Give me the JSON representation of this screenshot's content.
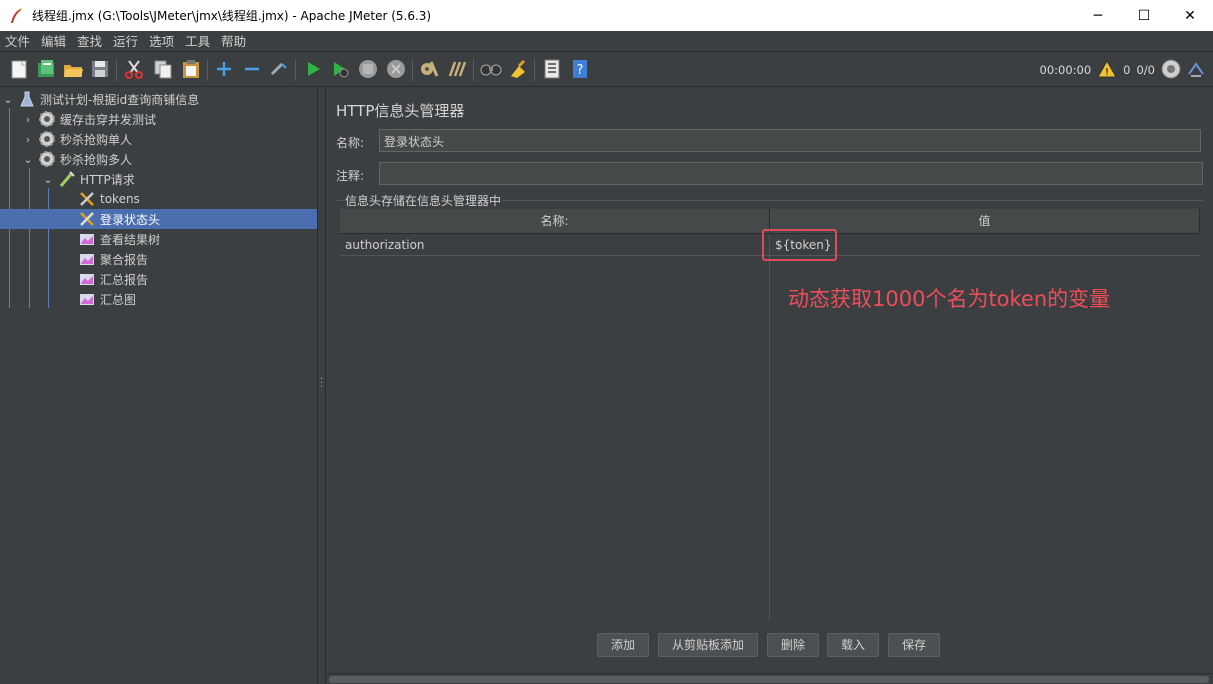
{
  "window": {
    "title": "线程组.jmx (G:\\Tools\\JMeter\\jmx\\线程组.jmx) - Apache JMeter (5.6.3)",
    "minimize": "─",
    "maximize": "☐",
    "close": "✕"
  },
  "menu": [
    "文件",
    "编辑",
    "查找",
    "运行",
    "选项",
    "工具",
    "帮助"
  ],
  "toolbar": {
    "buttons": [
      "new-icon",
      "templates-icon",
      "open-icon",
      "save-icon",
      "cut-icon",
      "copy-icon",
      "paste-icon",
      "expand-icon",
      "collapse-icon",
      "toggle-icon",
      "start-icon",
      "start-no-pause-icon",
      "stop-icon",
      "shutdown-icon",
      "clear-icon",
      "clear-all-icon",
      "search-icon",
      "reset-search-icon",
      "function-helper-icon",
      "help-icon"
    ],
    "timer": "00:00:00",
    "warnings": "0",
    "threads": "0/0"
  },
  "tree": {
    "items": [
      {
        "label": "测试计划-根据id查询商铺信息",
        "icon": "test-plan-icon",
        "level": 0,
        "expanded": true
      },
      {
        "label": "缓存击穿并发测试",
        "icon": "thread-group-icon",
        "level": 1,
        "expanded": false
      },
      {
        "label": "秒杀抢购单人",
        "icon": "thread-group-icon",
        "level": 1,
        "expanded": false
      },
      {
        "label": "秒杀抢购多人",
        "icon": "thread-group-icon",
        "level": 1,
        "expanded": true
      },
      {
        "label": "HTTP请求",
        "icon": "sampler-icon",
        "level": 2,
        "expanded": true
      },
      {
        "label": "tokens",
        "icon": "config-element-icon",
        "level": 3
      },
      {
        "label": "登录状态头",
        "icon": "config-element-icon",
        "level": 3,
        "selected": true
      },
      {
        "label": "查看结果树",
        "icon": "listener-icon",
        "level": 3
      },
      {
        "label": "聚合报告",
        "icon": "listener-icon",
        "level": 3
      },
      {
        "label": "汇总报告",
        "icon": "listener-icon",
        "level": 3
      },
      {
        "label": "汇总图",
        "icon": "listener-icon",
        "level": 3
      }
    ]
  },
  "panel": {
    "title": "HTTP信息头管理器",
    "name_label": "名称:",
    "name_value": "登录状态头",
    "comment_label": "注释:",
    "comment_value": "",
    "group_label": "信息头存储在信息头管理器中",
    "table": {
      "headers": [
        "名称:",
        "值"
      ],
      "rows": [
        {
          "name": "authorization",
          "value": "${token}"
        }
      ]
    },
    "annotation": "动态获取1000个名为token的变量",
    "buttons": [
      "添加",
      "从剪贴板添加",
      "删除",
      "载入",
      "保存"
    ]
  },
  "colors": {
    "background": "#3c3f41",
    "selection": "#4b6eaf",
    "annotation": "#ee4d5a"
  }
}
